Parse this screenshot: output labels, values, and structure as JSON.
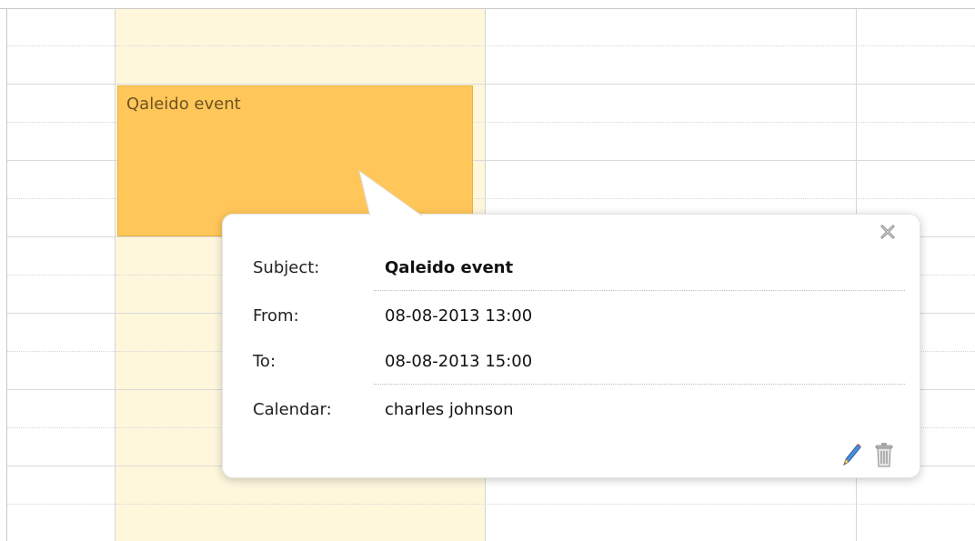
{
  "event": {
    "title": "Qaleido event"
  },
  "popover": {
    "rows": [
      {
        "label": "Subject:",
        "value": "Qaleido event"
      },
      {
        "label": "From:",
        "value": "08-08-2013 13:00"
      },
      {
        "label": "To:",
        "value": "08-08-2013 15:00"
      },
      {
        "label": "Calendar:",
        "value": "charles johnson"
      }
    ],
    "icons": {
      "close": "close-icon",
      "edit": "pencil-icon",
      "delete": "trash-icon"
    }
  },
  "colors": {
    "today_column": "#fff7dc",
    "event_fill": "#ffc75a",
    "event_border": "#e9ae3f",
    "event_text": "#6d5221"
  }
}
